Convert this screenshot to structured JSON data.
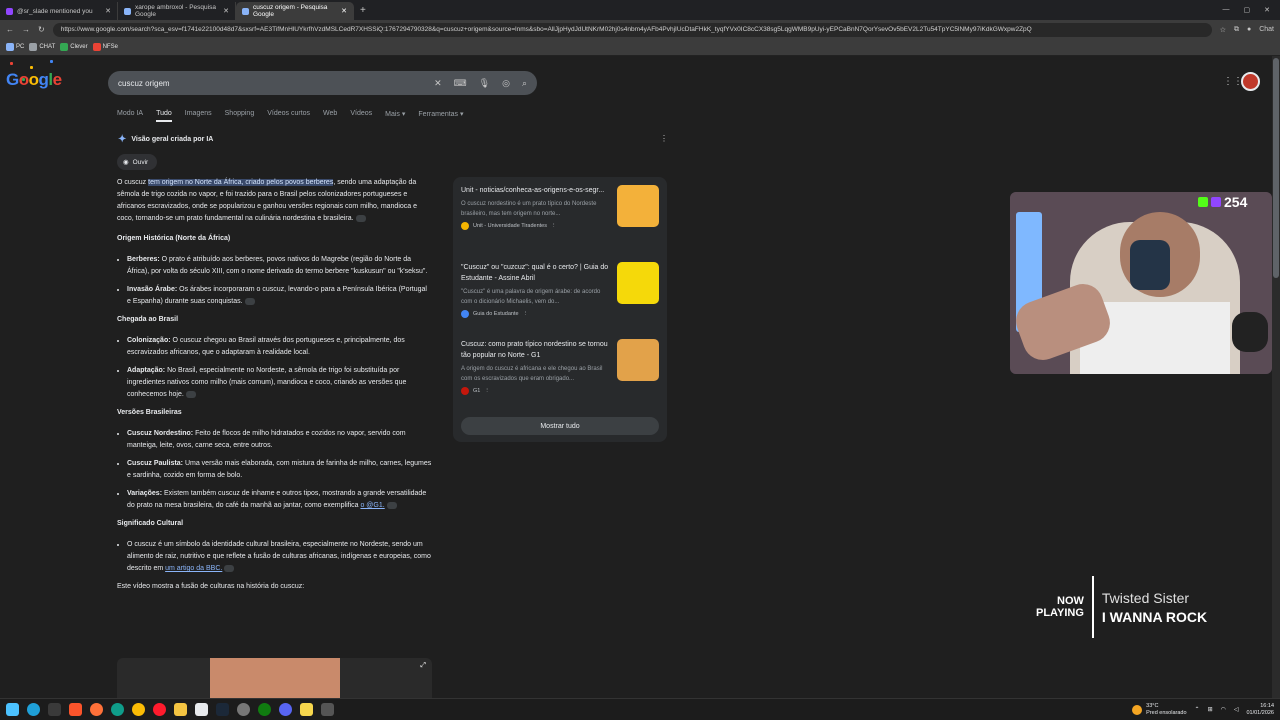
{
  "browser": {
    "tabs": [
      {
        "label": "@sr_slade mentioned you",
        "active": false
      },
      {
        "label": "xarope ambroxol - Pesquisa Google",
        "active": false
      },
      {
        "label": "cuscuz origem - Pesquisa Google",
        "active": true
      }
    ],
    "url": "https://www.google.com/search?sca_esv=f1741e22100d48d7&sxsrf=AE3TifMnHlUYkrfhVzdMSLCedR7XHSSiQ:1767294790328&q=cuscuz+origem&source=lnms&sbo=AllJjpHydJdUtNKrM02hj0s4nbm4yAFb4PvhjIUcDtaFHkK_tyqfYVx0IC8cCX38sg5LqgWMB9pUyi-yEPCaBnN7QorYsevOv5bEV2L2Tu54TpYC5lNMy97iKdkGWxpw2ZpQ",
    "bookmarks": [
      {
        "label": "PC",
        "color": "#8ab4f8"
      },
      {
        "label": "CHAT",
        "color": "#9aa0a6"
      },
      {
        "label": "Clever",
        "color": "#34a853"
      },
      {
        "label": "NFSe",
        "color": "#ea4335"
      }
    ]
  },
  "search": {
    "query": "cuscuz origem",
    "filters": [
      "Modo IA",
      "Tudo",
      "Imagens",
      "Shopping",
      "Vídeos curtos",
      "Web",
      "Vídeos",
      "Mais",
      "Ferramentas"
    ],
    "active_filter": "Tudo"
  },
  "overview": {
    "heading": "Visão geral criada por IA",
    "listen_label": "Ouvir",
    "intro_pre": "O cuscuz ",
    "intro_highlight": "tem origem no Norte da África, criado pelos povos berberes",
    "intro_post": ", sendo uma adaptação da sêmola de trigo cozida no vapor, e foi trazido para o Brasil pelos colonizadores portugueses e africanos escravizados, onde se popularizou e ganhou versões regionais com milho, mandioca e coco, tornando-se um prato fundamental na culinária nordestina e brasileira.",
    "sections": [
      {
        "title": "Origem Histórica (Norte da África)",
        "items": [
          {
            "term": "Berberes:",
            "text": " O prato é atribuído aos berberes, povos nativos do Magrebe (região do Norte da África), por volta do século XIII, com o nome derivado do termo berbere \"kuskusun\" ou \"k'seksu\"."
          },
          {
            "term": "Invasão Árabe:",
            "text": " Os árabes incorporaram o cuscuz, levando-o para a Península Ibérica (Portugal e Espanha) durante suas conquistas."
          }
        ]
      },
      {
        "title": "Chegada ao Brasil",
        "items": [
          {
            "term": "Colonização:",
            "text": " O cuscuz chegou ao Brasil através dos portugueses e, principalmente, dos escravizados africanos, que o adaptaram à realidade local."
          },
          {
            "term": "Adaptação:",
            "text": " No Brasil, especialmente no Nordeste, a sêmola de trigo foi substituída por ingredientes nativos como milho (mais comum), mandioca e coco, criando as versões que conhecemos hoje."
          }
        ]
      },
      {
        "title": "Versões Brasileiras",
        "items": [
          {
            "term": "Cuscuz Nordestino:",
            "text": " Feito de flocos de milho hidratados e cozidos no vapor, servido com manteiga, leite, ovos, carne seca, entre outros."
          },
          {
            "term": "Cuscuz Paulista:",
            "text": " Uma versão mais elaborada, com mistura de farinha de milho, carnes, legumes e sardinha, cozido em forma de bolo."
          },
          {
            "term": "Variações:",
            "text": " Existem também cuscuz de inhame e outros tipos, mostrando a grande versatilidade do prato na mesa brasileira, do café da manhã ao jantar, como exemplifica ",
            "link": "o @G1."
          }
        ]
      },
      {
        "title": "Significado Cultural",
        "items": [
          {
            "term": "",
            "text": "O cuscuz é um símbolo da identidade cultural brasileira, especialmente no Nordeste, sendo um alimento de raiz, nutritivo e que reflete a fusão de culturas africanas, indígenas e europeias, como descrito em ",
            "link": "um artigo da BBC."
          }
        ]
      }
    ],
    "video_caption": "Este vídeo mostra a fusão de culturas na história do cuscuz:"
  },
  "sources": {
    "items": [
      {
        "title": "Unit - noticias/conheca-as-origens-e-os-segr...",
        "snippet": "O cuscuz nordestino é um prato típico do Nordeste brasileiro, mas tem origem no norte...",
        "site": "Unit - Universidade Tiradentes",
        "color": "#f4b400",
        "thumb_color": "#f3b13a"
      },
      {
        "title": "\"Cuscuz\" ou \"cuzcuz\": qual é o certo? | Guia do Estudante - Assine Abril",
        "snippet": "\"Cuscuz\" é uma palavra de origem árabe: de acordo com o dicionário Michaelis, vem do...",
        "site": "Guia do Estudante",
        "color": "#4285f4",
        "thumb_color": "#f5d90a"
      },
      {
        "title": "Cuscuz: como prato típico nordestino se tornou tão popular no Norte - G1",
        "snippet": "A origem do cuscuz é africana e ele chegou ao Brasil com os escravizados que eram obrigado...",
        "site": "G1",
        "color": "#c4170c",
        "thumb_color": "#e2a24a"
      }
    ],
    "show_all": "Mostrar tudo"
  },
  "stream": {
    "viewer_count": "254",
    "now_playing_label_1": "NOW",
    "now_playing_label_2": "PLAYING",
    "artist": "Twisted Sister",
    "song": "I WANNA ROCK"
  },
  "taskbar": {
    "temperature": "33°C",
    "weather_text": "Pred ensolarado",
    "time": "16:14",
    "date": "01/01/2026"
  }
}
